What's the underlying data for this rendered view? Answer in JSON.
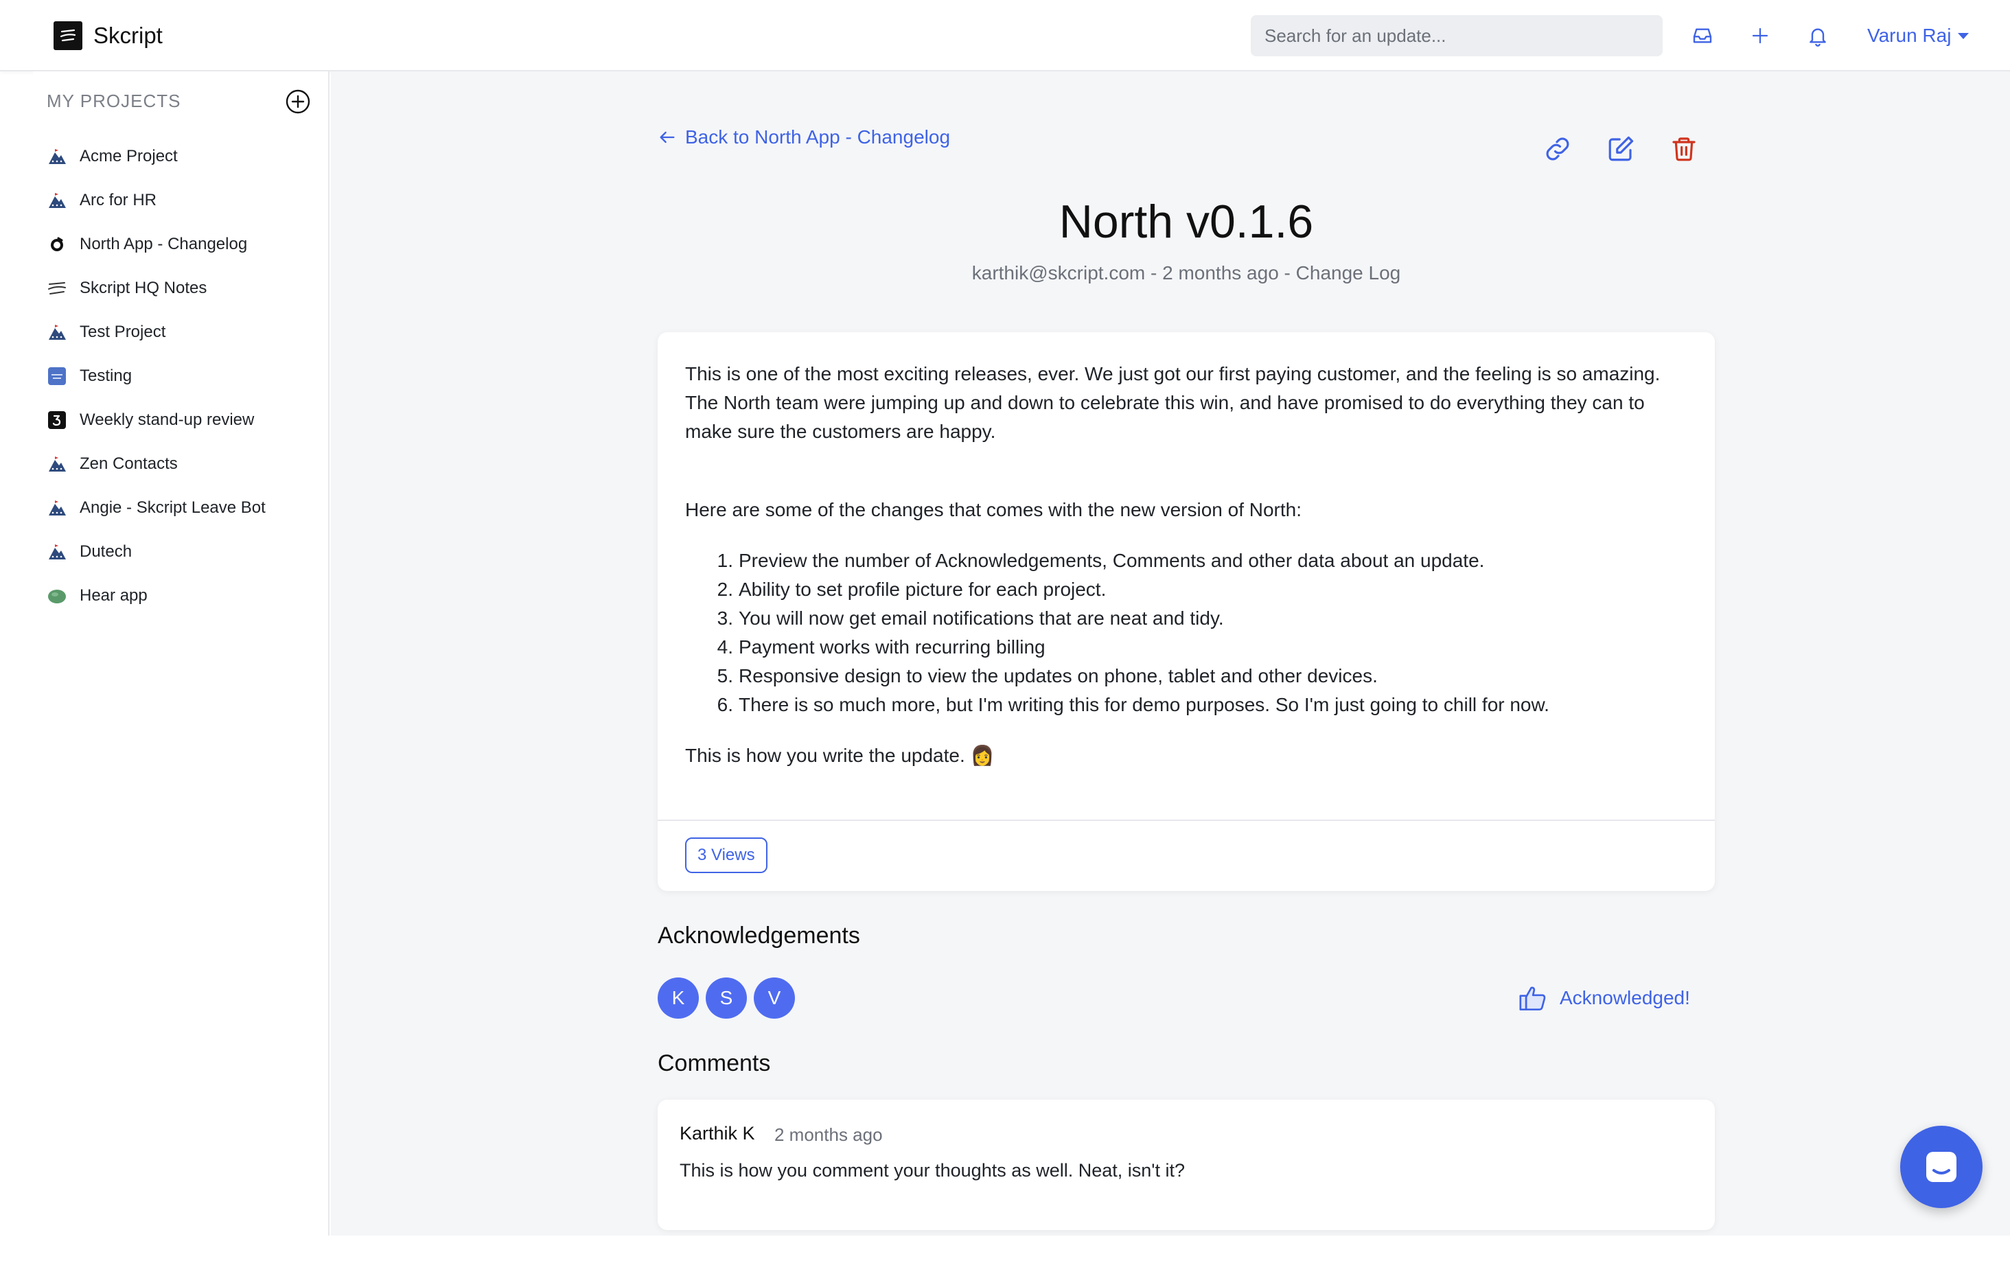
{
  "brand": {
    "name": "Skcript"
  },
  "header": {
    "search_placeholder": "Search for an update...",
    "icons": [
      "inbox-icon",
      "plus-icon",
      "bell-icon"
    ],
    "user_name": "Varun Raj"
  },
  "sidebar": {
    "title": "MY PROJECTS",
    "items": [
      {
        "label": "Acme Project",
        "icon": "project-avatar-icon"
      },
      {
        "label": "Arc for HR",
        "icon": "project-avatar-icon"
      },
      {
        "label": "North App - Changelog",
        "icon": "north-logo-icon"
      },
      {
        "label": "Skcript HQ Notes",
        "icon": "skcript-logo-icon"
      },
      {
        "label": "Test Project",
        "icon": "project-avatar-icon"
      },
      {
        "label": "Testing",
        "icon": "testing-thumbnail-icon"
      },
      {
        "label": "Weekly stand-up review",
        "icon": "number-three-icon"
      },
      {
        "label": "Zen Contacts",
        "icon": "project-avatar-icon"
      },
      {
        "label": "Angie - Skcript Leave Bot",
        "icon": "project-avatar-icon"
      },
      {
        "label": "Dutech",
        "icon": "project-avatar-icon"
      },
      {
        "label": "Hear app",
        "icon": "green-blob-icon"
      }
    ]
  },
  "post": {
    "back_label": "Back to North App - Changelog",
    "title": "North v0.1.6",
    "meta": "karthik@skcript.com - 2 months ago - Change Log",
    "intro": "This is one of the most exciting releases, ever. We just got our first paying customer, and the feeling is so amazing. The North team were jumping up and down to celebrate this win, and have promised to do everything they can to make sure the customers are happy.",
    "changes_intro": "Here are some of the changes that comes with the new version of North:",
    "changes": [
      "Preview the number of Acknowledgements, Comments and other data about an update.",
      "Ability to set profile picture for each project.",
      "You will now get email notifications that are neat and tidy.",
      "Payment works with recurring billing",
      "Responsive design to view the updates on phone, tablet and other devices.",
      "There is so much more, but I'm writing this for demo purposes. So I'm just going to chill for now."
    ],
    "outro": "This is how you write the update. 👩",
    "views": "3 Views"
  },
  "acknowledgements": {
    "heading": "Acknowledgements",
    "avatars": [
      "K",
      "S",
      "V"
    ],
    "button_label": "Acknowledged!"
  },
  "comments": {
    "heading": "Comments",
    "items": [
      {
        "author": "Karthik K",
        "time": "2 months ago",
        "text": "This is how you comment your thoughts as well. Neat, isn't it?"
      }
    ]
  },
  "colors": {
    "accent": "#3f63e5",
    "danger": "#d0341d",
    "avatar": "#4f6cf0"
  }
}
